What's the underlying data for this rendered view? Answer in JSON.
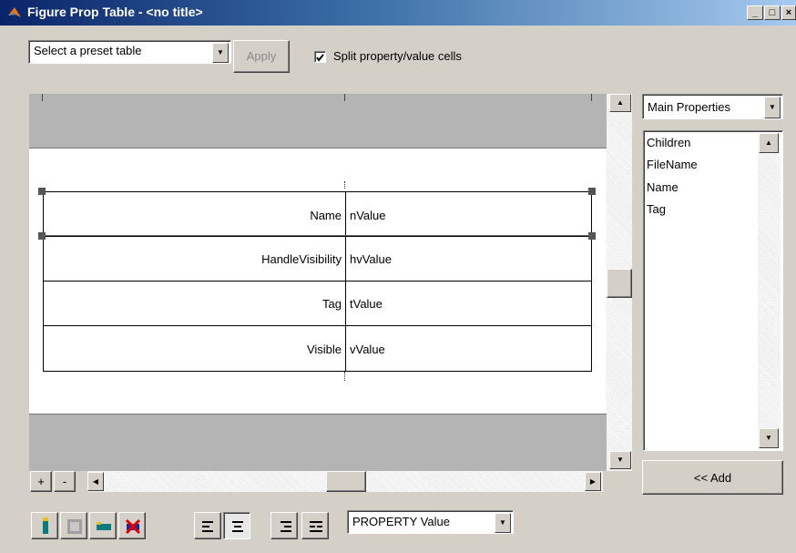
{
  "window": {
    "title": "Figure Prop Table - <no title>",
    "controls": [
      "_",
      "□",
      "×"
    ]
  },
  "toolbar": {
    "preset_select": "Select a preset table",
    "apply_label": "Apply",
    "split_checkbox_label": "Split property/value cells",
    "split_checked": true
  },
  "table": {
    "rows": [
      {
        "property": "Name",
        "value": "nValue"
      },
      {
        "property": "HandleVisibility",
        "value": "hvValue"
      },
      {
        "property": "Tag",
        "value": "tValue"
      },
      {
        "property": "Visible",
        "value": "vValue"
      }
    ]
  },
  "canvas_controls": {
    "plus_label": "+",
    "minus_label": "-"
  },
  "properties_panel": {
    "category_select": "Main Properties",
    "items": [
      "Children",
      "FileName",
      "Name",
      "Tag"
    ],
    "add_label": "<< Add"
  },
  "bottom_toolbar": {
    "icons": [
      "insert-row-icon",
      "merge-cells-icon",
      "border-icon",
      "delete-icon"
    ],
    "align_icons": [
      "align-left-icon",
      "align-center-icon",
      "align-right-icon",
      "justify-icon"
    ],
    "format_select": "PROPERTY Value"
  }
}
